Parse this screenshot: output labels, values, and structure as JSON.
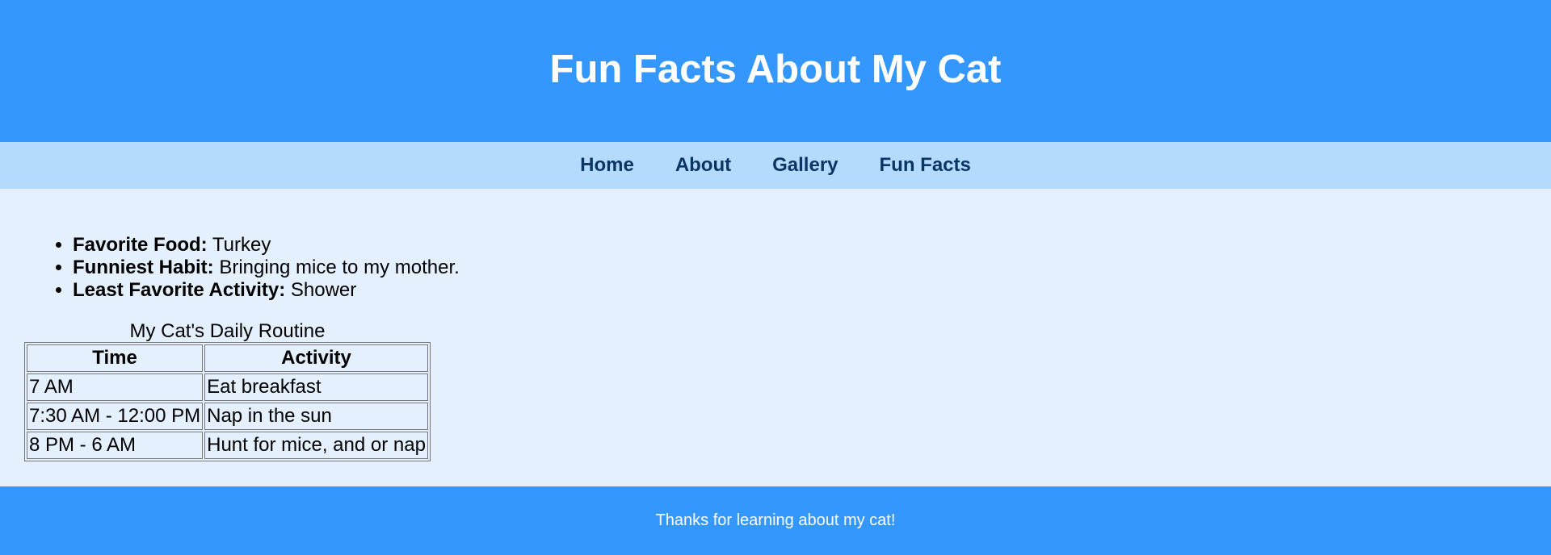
{
  "header": {
    "title": "Fun Facts About My Cat"
  },
  "nav": {
    "items": [
      {
        "label": "Home"
      },
      {
        "label": "About"
      },
      {
        "label": "Gallery"
      },
      {
        "label": "Fun Facts"
      }
    ]
  },
  "facts": [
    {
      "label": "Favorite Food:",
      "value": "Turkey"
    },
    {
      "label": "Funniest Habit:",
      "value": "Bringing mice to my mother."
    },
    {
      "label": "Least Favorite Activity:",
      "value": "Shower"
    }
  ],
  "routine": {
    "caption": "My Cat's Daily Routine",
    "headers": [
      "Time",
      "Activity"
    ],
    "rows": [
      [
        "7 AM",
        "Eat breakfast"
      ],
      [
        "7:30 AM - 12:00 PM",
        "Nap in the sun"
      ],
      [
        "8 PM - 6 AM",
        "Hunt for mice, and or nap"
      ]
    ]
  },
  "footer": {
    "text": "Thanks for learning about my cat!"
  },
  "colors": {
    "header_bg": "#3497fe",
    "nav_bg": "#b4dafe",
    "nav_text": "#0a3664",
    "main_bg": "#e4f0fe",
    "footer_bg": "#3497fe"
  }
}
